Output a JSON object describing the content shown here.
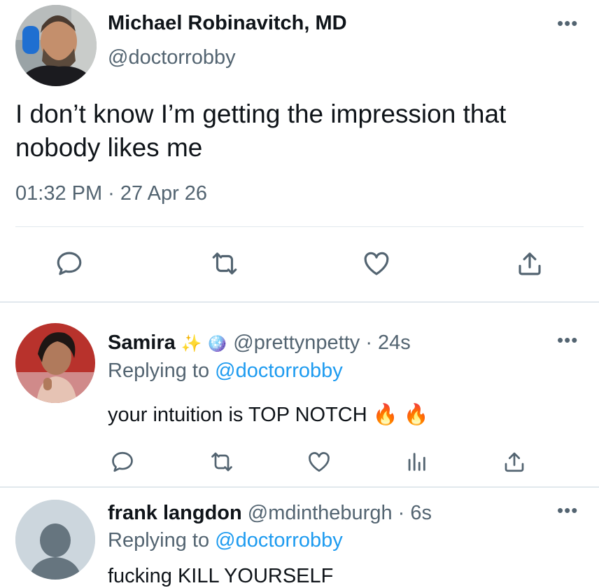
{
  "colors": {
    "accent": "#1d9bf0",
    "secondary_text": "#536471",
    "divider": "#e1e8ed"
  },
  "main_tweet": {
    "author_name": "Michael Robinavitch, MD",
    "handle": "@doctorrobby",
    "text": "I don’t know I’m getting the impression that nobody likes me",
    "timestamp": "01:32 PM · 27 Apr 26",
    "more_icon": "more-horizontal-icon",
    "actions": [
      "reply-icon",
      "retweet-icon",
      "like-icon",
      "share-icon"
    ]
  },
  "replies": [
    {
      "author_name": "Samira",
      "name_emojis": "✨ 🪩",
      "handle": "@prettynpetty",
      "time": "· 24s",
      "replying_prefix": "Replying to",
      "replying_handle": "@doctorrobby",
      "text": "your intuition is TOP NOTCH 🔥 🔥",
      "actions": [
        "reply-icon",
        "retweet-icon",
        "like-icon",
        "analytics-icon",
        "share-icon"
      ]
    },
    {
      "author_name": "frank langdon",
      "handle": "@mdintheburgh",
      "time": "· 6s",
      "replying_prefix": "Replying to",
      "replying_handle": "@doctorrobby",
      "text": "fucking KILL YOURSELF"
    }
  ]
}
